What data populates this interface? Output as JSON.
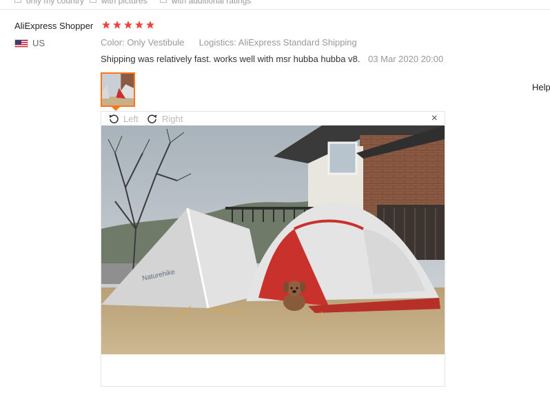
{
  "top_strip": {
    "item1_text": "only my country",
    "item2_text": "with pictures",
    "item3_text": "with additional ratings"
  },
  "review": {
    "buyer_name": "AliExpress Shopper",
    "country": "US",
    "rating_stars": 5,
    "color_label": "Color:",
    "color_value": "Only Vestibule",
    "logistics_label": "Logistics:",
    "logistics_value": "AliExpress Standard Shipping",
    "text": "Shipping was relatively fast. works well with msr hubba hubba v8.",
    "date": "03 Mar 2020 20:00"
  },
  "side": {
    "help_text": "Help"
  },
  "viewer": {
    "rotate_left_label": "Left",
    "rotate_right_label": "Right",
    "close_glyph": "×"
  },
  "colors": {
    "accent": "#ff7519",
    "star": "#f0443b",
    "muted_text": "#999999"
  },
  "icons": [
    "us-flag-icon",
    "star-icon",
    "rotate-left-icon",
    "rotate-right-icon",
    "close-icon"
  ]
}
